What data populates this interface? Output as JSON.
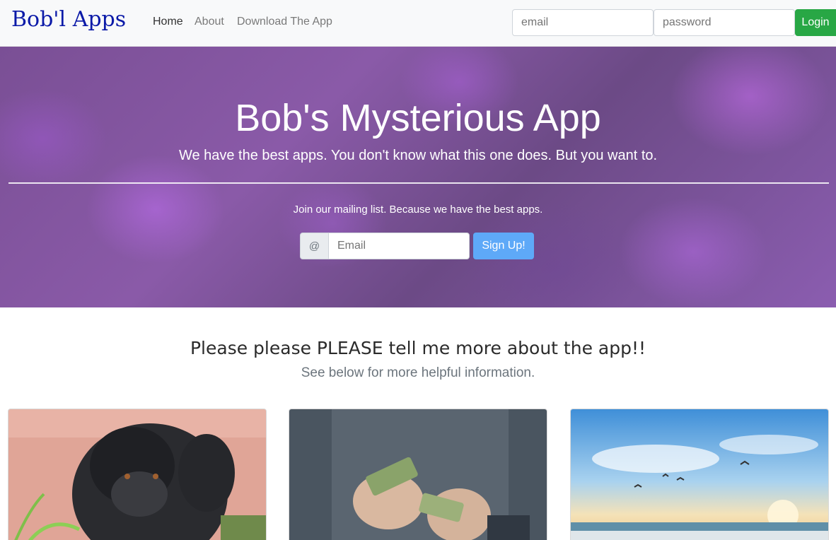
{
  "navbar": {
    "brand": "Bob'l Apps",
    "links": [
      "Home",
      "About",
      "Download The App"
    ],
    "email_placeholder": "email",
    "password_placeholder": "password",
    "login_label": "Login"
  },
  "hero": {
    "title": "Bob's Mysterious App",
    "subtitle": "We have the best apps. You don't know what this one does. But you want to.",
    "mailing_text": "Join our mailing list. Because we have the best apps.",
    "at_symbol": "@",
    "email_placeholder": "Email",
    "signup_label": "Sign Up!"
  },
  "info": {
    "title": "Please please PLEASE tell me more about the app!!",
    "subtitle": "See below for more helpful information."
  },
  "cards": [
    {
      "image": "gorilla-thinking-image"
    },
    {
      "image": "person-counting-money-image"
    },
    {
      "image": "beach-sunset-seagulls-image"
    }
  ],
  "colors": {
    "brand": "#0b1aa8",
    "login_green": "#28a745",
    "signup_blue": "#5ea9f8",
    "hero_purple": "#7a4f95"
  }
}
